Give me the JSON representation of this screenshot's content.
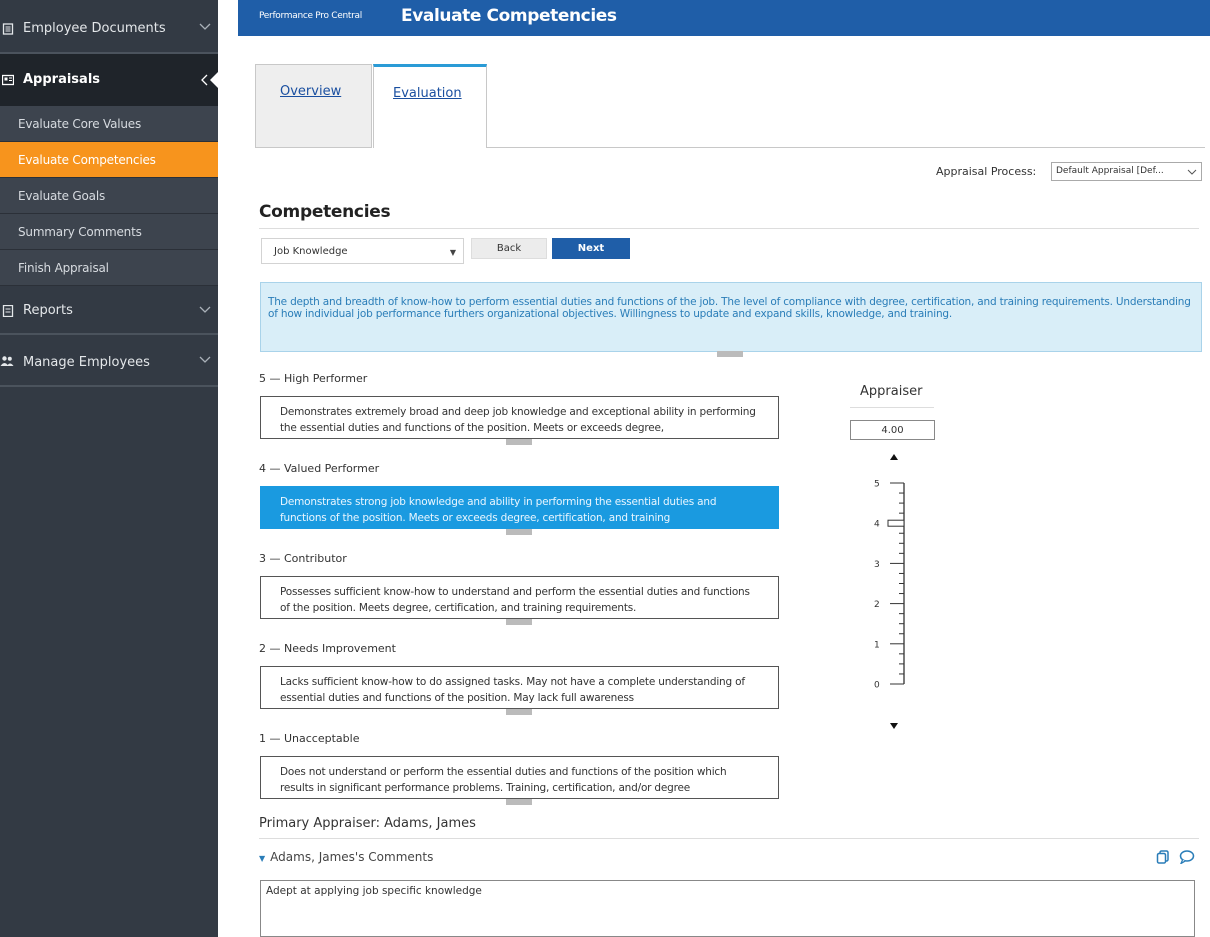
{
  "sidebar": {
    "top_items": [
      {
        "label": "Employee Documents",
        "icon": "document-icon"
      },
      {
        "label": "Appraisals",
        "icon": "appraisal-card-icon"
      },
      {
        "label": "Reports",
        "icon": "report-icon"
      },
      {
        "label": "Manage Employees",
        "icon": "people-icon"
      }
    ],
    "sub_items": [
      {
        "label": "Evaluate Core Values"
      },
      {
        "label": "Evaluate Competencies",
        "active": true
      },
      {
        "label": "Evaluate Goals"
      },
      {
        "label": "Summary Comments"
      },
      {
        "label": "Finish Appraisal"
      }
    ]
  },
  "header": {
    "brand": "Performance Pro Central",
    "title": "Evaluate Competencies",
    "bg_color": "#1f5ea8"
  },
  "tabs": [
    {
      "label": "Overview",
      "active": false
    },
    {
      "label": "Evaluation",
      "active": true
    }
  ],
  "appraisal_process": {
    "label": "Appraisal Process:",
    "value": "Default Appraisal [Def..."
  },
  "competencies": {
    "title": "Competencies",
    "selected": "Job Knowledge",
    "back_label": "Back",
    "next_label": "Next",
    "description": "The depth and breadth of know-how to perform essential duties and functions of the job. The level of compliance with degree, certification, and training requirements. Understanding of how individual job performance furthers organizational objectives. Willingness to update and expand skills, knowledge, and training."
  },
  "levels": [
    {
      "label": "5 — High Performer",
      "text": "Demonstrates extremely broad and deep job knowledge and exceptional ability in performing the essential duties and functions of the position. Meets or exceeds degree,",
      "selected": false
    },
    {
      "label": "4 — Valued Performer",
      "text": "Demonstrates strong job knowledge and ability in performing the essential duties and functions of the position. Meets or exceeds degree, certification, and training",
      "selected": true
    },
    {
      "label": "3 — Contributor",
      "text": "Possesses sufficient know-how to understand and perform the essential duties and functions of the position. Meets degree, certification, and training requirements.",
      "selected": false
    },
    {
      "label": "2 — Needs Improvement",
      "text": "Lacks sufficient know-how to do assigned tasks. May not have a complete understanding of essential duties and functions of the position. May lack full awareness",
      "selected": false
    },
    {
      "label": "1 — Unacceptable",
      "text": "Does not understand or perform the essential duties and functions of the position which results in significant performance problems. Training, certification, and/or degree",
      "selected": false
    }
  ],
  "appraiser": {
    "label": "Appraiser",
    "rating": "4.00",
    "scale_labels": [
      "5",
      "4",
      "3",
      "2",
      "1",
      "0"
    ],
    "rating_value": 4
  },
  "comments": {
    "primary_appraiser": "Primary Appraiser: Adams, James",
    "header": "Adams, James's Comments",
    "text": "Adept at applying job specific knowledge"
  },
  "colors": {
    "sidebar_bg": "#333a44",
    "accent_orange": "#f7941d",
    "selected_blue": "#1a9ae0",
    "desc_bg": "#d9eef8"
  }
}
